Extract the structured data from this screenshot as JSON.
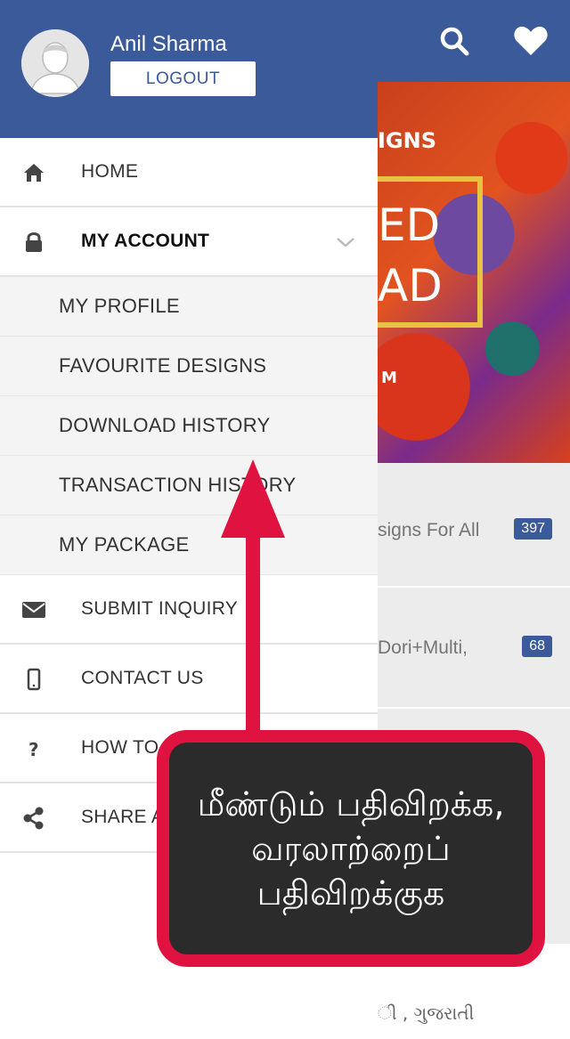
{
  "background": {
    "banner_text_1": "IGNS",
    "banner_text_2": "ED",
    "banner_text_3": "AD",
    "banner_text_4": "M",
    "list": [
      {
        "text": "signs For All",
        "count": "397"
      },
      {
        "text": "Dori+Multi,",
        "count": "68"
      }
    ],
    "bottom_text": "ી , ગુજરાતી"
  },
  "user": {
    "name": "Anil Sharma",
    "logout_label": "LOGOUT"
  },
  "menu": {
    "home": "HOME",
    "my_account": "MY ACCOUNT",
    "sub": {
      "my_profile": "MY PROFILE",
      "favourite_designs": "FAVOURITE DESIGNS",
      "download_history": "DOWNLOAD HISTORY",
      "transaction_history": "TRANSACTION HISTORY",
      "my_package": "MY PACKAGE"
    },
    "submit_inquiry": "SUBMIT INQUIRY",
    "contact_us": "CONTACT US",
    "how_to_use": "HOW TO USE",
    "share_app": "SHARE APP"
  },
  "annotation": {
    "line1": "மீண்டும் பதிவிறக்க,",
    "line2": "வரலாற்றைப்",
    "line3": "பதிவிறக்குக",
    "accent_color": "#e0123f"
  },
  "colors": {
    "brand": "#3b5a9a"
  },
  "icons": {
    "search": "search-icon",
    "favourite": "heart-icon",
    "home": "home-icon",
    "account": "lock-icon",
    "expand": "chevron-down-icon",
    "inquiry": "envelope-icon",
    "contact": "mobile-icon",
    "help": "question-icon",
    "share": "share-icon"
  }
}
